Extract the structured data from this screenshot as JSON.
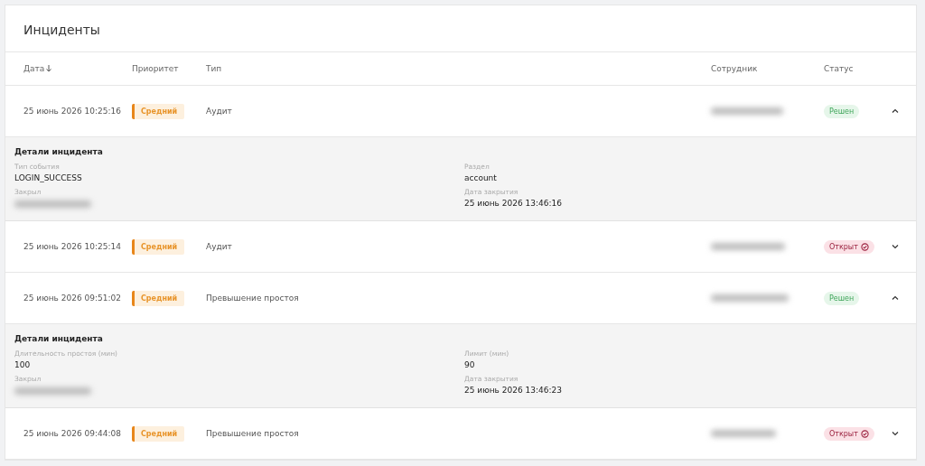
{
  "title": "Инциденты",
  "columns": [
    {
      "label": "Дата",
      "sorted_descending": true
    },
    {
      "label": "Приоритет"
    },
    {
      "label": "Тип"
    },
    {
      "label": "Сотрудник"
    },
    {
      "label": "Статус"
    }
  ],
  "rows": [
    {
      "date": "25 июнь 2026 10:25:16",
      "priority": "Средний",
      "type": "Аудит",
      "status": {
        "label": "Решен",
        "kind": "resolved"
      },
      "expanded": true,
      "details": {
        "heading": "Детали инцидента",
        "left": [
          {
            "label": "Тип события",
            "value": "LOGIN_SUCCESS"
          },
          {
            "label": "Закрыл",
            "redacted": true
          }
        ],
        "right": [
          {
            "label": "Раздел",
            "value": "account"
          },
          {
            "label": "Дата закрытия",
            "value": "25 июнь 2026 13:46:16"
          }
        ]
      }
    },
    {
      "date": "25 июнь 2026 10:25:14",
      "priority": "Средний",
      "type": "Аудит",
      "status": {
        "label": "Открыт",
        "kind": "open"
      },
      "expanded": false
    },
    {
      "date": "25 июнь 2026 09:51:02",
      "priority": "Средний",
      "type": "Превышение простоя",
      "status": {
        "label": "Решен",
        "kind": "resolved"
      },
      "expanded": true,
      "details": {
        "heading": "Детали инцидента",
        "left": [
          {
            "label": "Длительность простоя (мин)",
            "value": "100"
          },
          {
            "label": "Закрыл",
            "redacted": true
          }
        ],
        "right": [
          {
            "label": "Лимит (мин)",
            "value": "90"
          },
          {
            "label": "Дата закрытия",
            "value": "25 июнь 2026 13:46:23"
          }
        ]
      }
    },
    {
      "date": "25 июнь 2026 09:44:08",
      "priority": "Средний",
      "type": "Превышение простоя",
      "status": {
        "label": "Открыт",
        "kind": "open"
      },
      "expanded": false
    }
  ]
}
